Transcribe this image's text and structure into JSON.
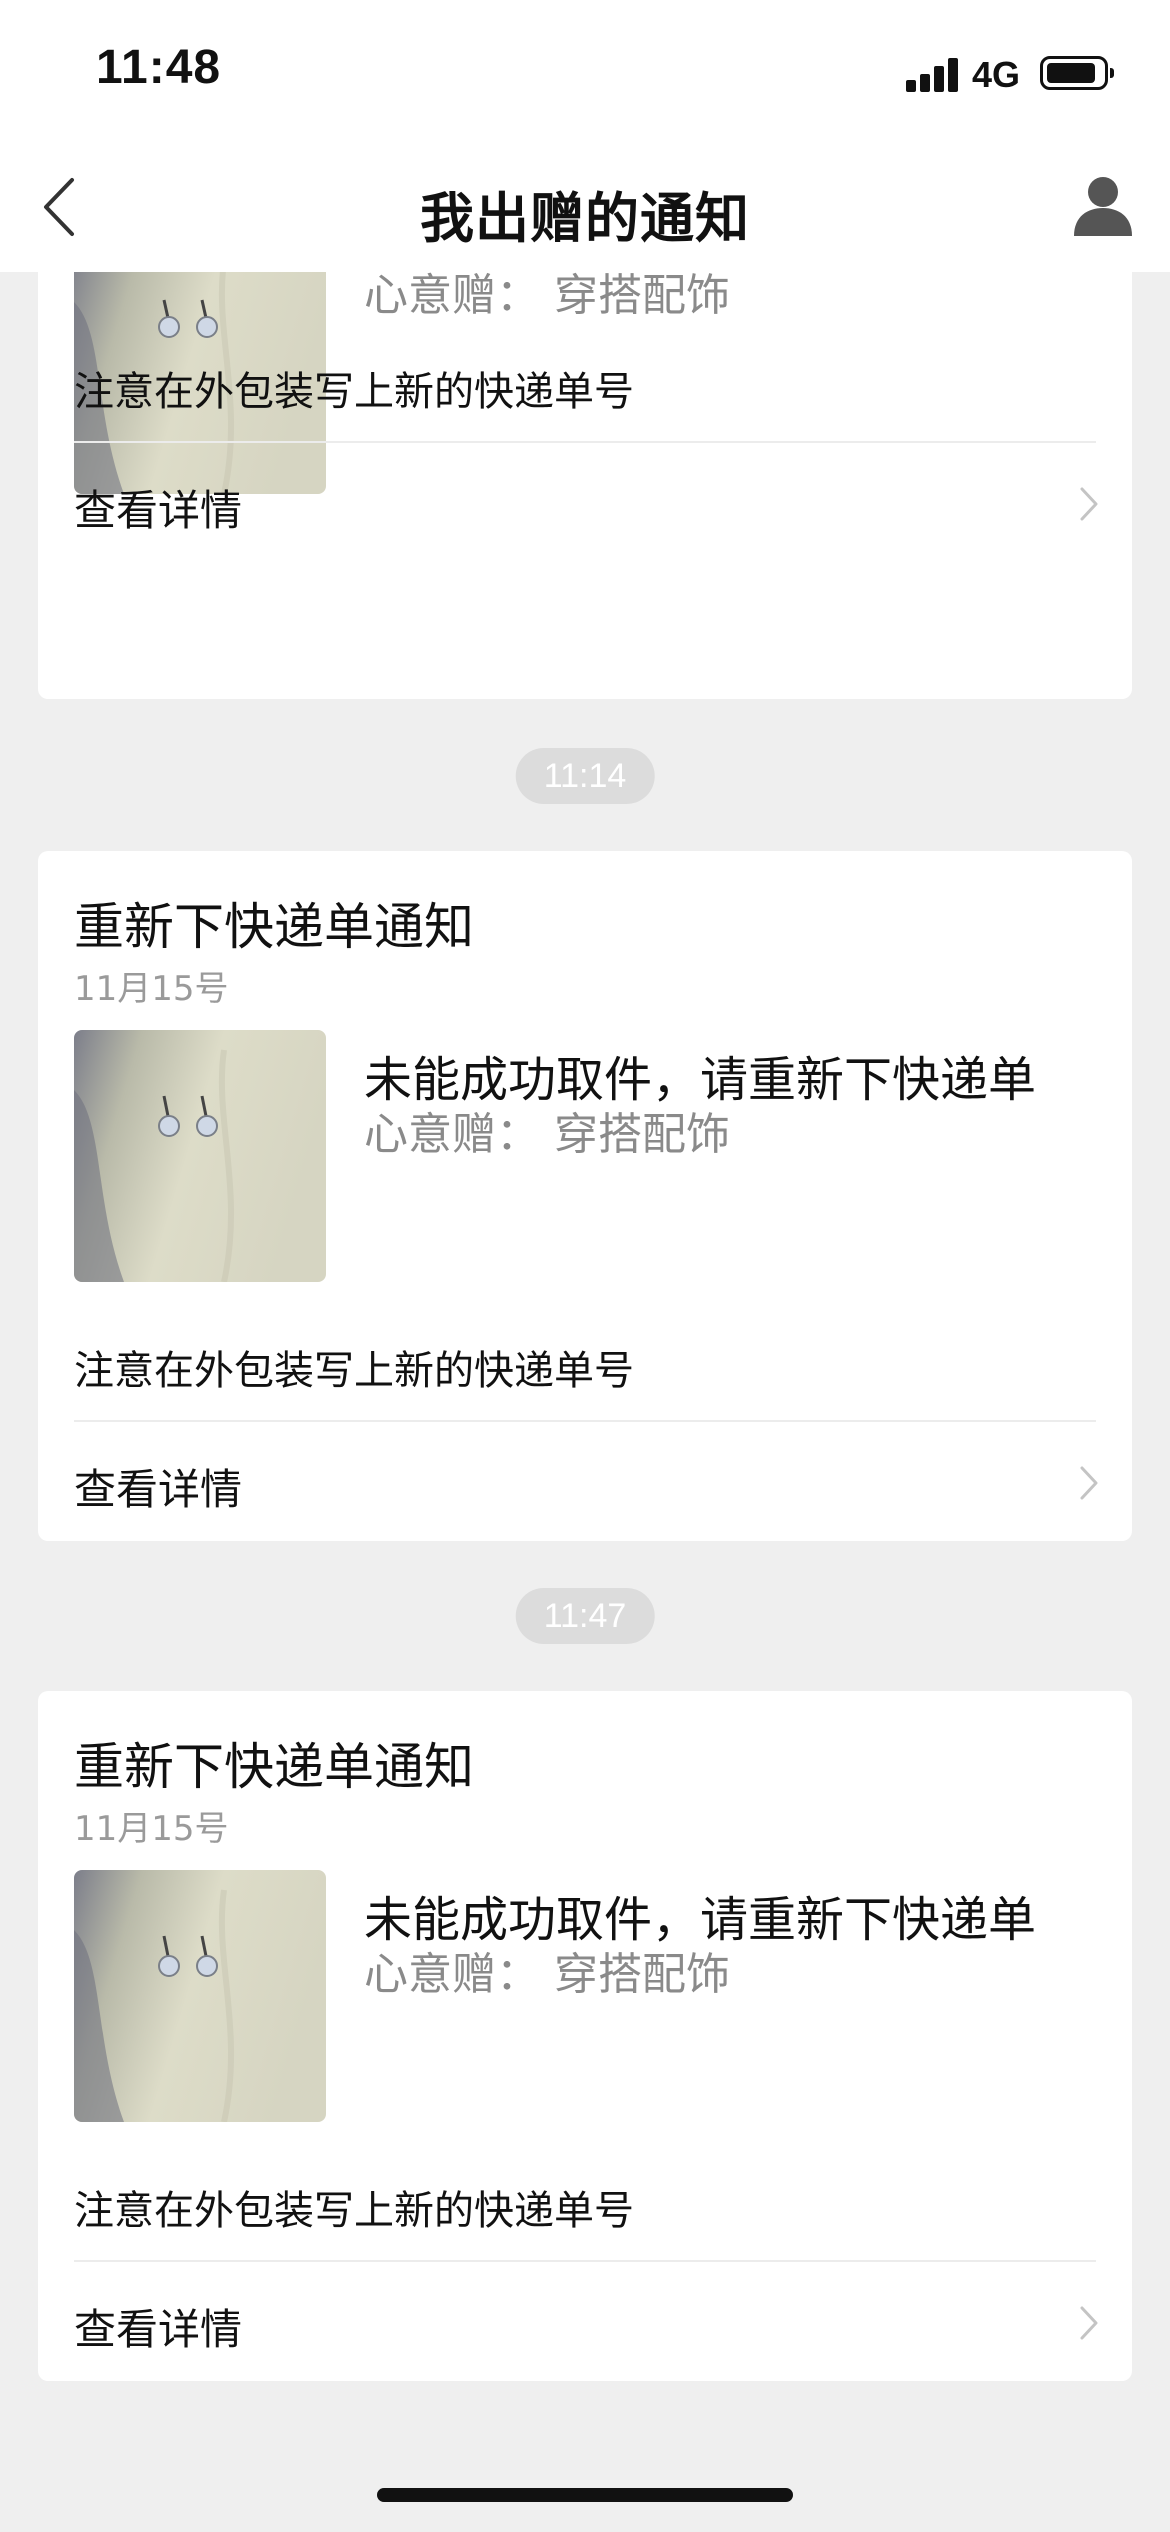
{
  "status_bar": {
    "time": "11:48",
    "network": "4G"
  },
  "nav": {
    "title": "我出赠的通知"
  },
  "partial_card": {
    "subline": "心意赠：  穿搭配饰",
    "note": "注意在外包装写上新的快递单号",
    "details": "查看详情"
  },
  "cards": [
    {
      "timestamp": "11:14",
      "title": "重新下快递单通知",
      "date": "11月15号",
      "headline": "未能成功取件，请重新下快递单",
      "subline": "心意赠：  穿搭配饰",
      "note": "注意在外包装写上新的快递单号",
      "details": "查看详情"
    },
    {
      "timestamp": "11:47",
      "title": "重新下快递单通知",
      "date": "11月15号",
      "headline": "未能成功取件，请重新下快递单",
      "subline": "心意赠：  穿搭配饰",
      "note": "注意在外包装写上新的快递单号",
      "details": "查看详情"
    }
  ],
  "icons": {
    "back": "chevron-left-icon",
    "profile": "person-icon",
    "row_arrow": "chevron-right-icon",
    "thumbnail": "earrings-photo"
  },
  "colors": {
    "page_background": "#efefef",
    "card_background": "#ffffff",
    "secondary_text": "#8a8a8a",
    "timestamp_pill": "#dcdcdc"
  }
}
